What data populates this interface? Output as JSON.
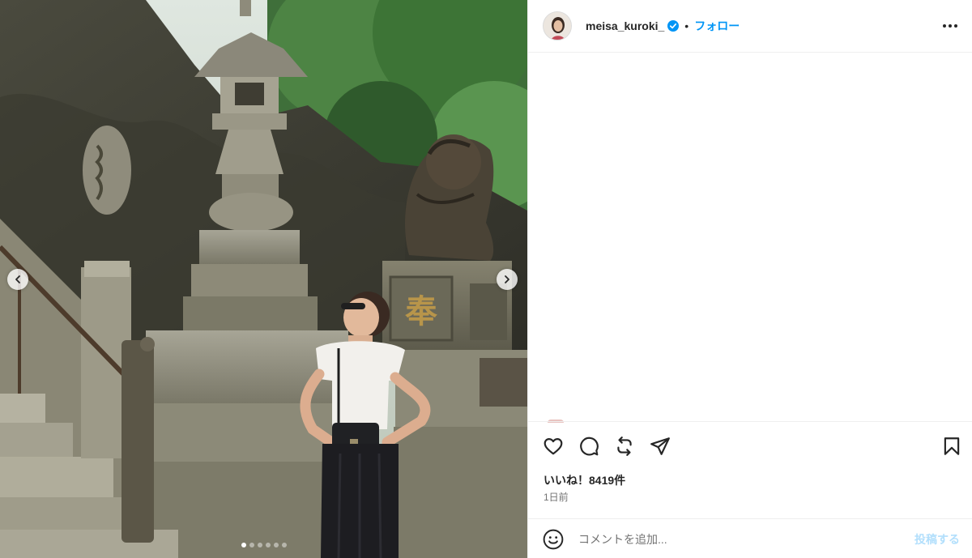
{
  "post": {
    "username": "meisa_kuroki_",
    "verified": true,
    "separator": "•",
    "follow_label": "フォロー",
    "likes_text": "いいね！8419件",
    "time_text": "1日前",
    "comment_placeholder": "コメントを追加...",
    "post_label": "投稿する"
  },
  "carousel": {
    "slide_count": 6,
    "active_index": 0
  },
  "icons": {
    "more": "more-options-icon",
    "like": "heart-icon",
    "comment": "comment-icon",
    "repost": "repost-icon",
    "share": "share-icon",
    "save": "bookmark-icon",
    "emoji": "emoji-icon",
    "prev": "chevron-left-icon",
    "next": "chevron-right-icon"
  },
  "colors": {
    "accent": "#0095f6",
    "verified": "#0095f6",
    "post_disabled": "#b2dffc",
    "text": "#262626",
    "muted": "#737373"
  }
}
